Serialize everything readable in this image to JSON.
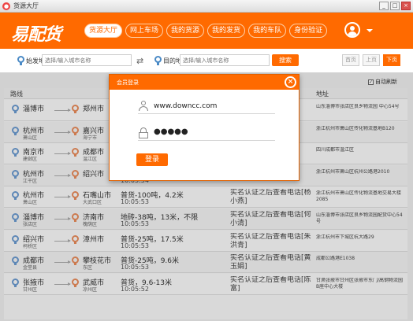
{
  "window": {
    "title": "货源大厅",
    "minimize": "_",
    "maximize": "□",
    "close": "×",
    "app_icon": "app-icon"
  },
  "brand": {
    "logo": "易配货"
  },
  "nav": [
    "货源大厅",
    "网上车场",
    "我的货源",
    "我的发货",
    "我的车队",
    "身份验证"
  ],
  "nav_active": 0,
  "search": {
    "from_label": "始发地",
    "from_placeholder": "选择/输入城市名称",
    "to_label": "目的地",
    "to_placeholder": "选择/输入城市名称",
    "swap": "⇄",
    "button": "搜索",
    "first": "首页",
    "prev": "上页",
    "next": "下页"
  },
  "auto_refresh": {
    "label": "自动刷新",
    "checked": true,
    "check": "✓"
  },
  "table": {
    "headers": {
      "route": "路线",
      "address": "地址"
    },
    "rows": [
      {
        "from": "淄博市",
        "from_sub": "",
        "to": "郑州市",
        "to_sub": "",
        "cargo": "",
        "time": "",
        "contact": "",
        "address": "山东淄博市张店区良乡物流园 中心54号"
      },
      {
        "from": "杭州市",
        "from_sub": "萧山区",
        "to": "嘉兴市",
        "to_sub": "海宁市",
        "cargo": "",
        "time": "",
        "contact": "",
        "address": "浙江杭州市萧山区传化物流基地B120"
      },
      {
        "from": "南京市",
        "from_sub": "建邺区",
        "to": "成都市",
        "to_sub": "温江区",
        "cargo": "",
        "time": "",
        "contact": "",
        "address": "四川成都市温江区"
      },
      {
        "from": "杭州市",
        "from_sub": "江干区",
        "to": "绍兴市",
        "to_sub": "",
        "cargo": "",
        "time": "10:05:54",
        "contact": "人]",
        "address": "浙江杭州市萧山区杭州公路港2010"
      },
      {
        "from": "杭州市",
        "from_sub": "萧山区",
        "to": "石嘴山市",
        "to_sub": "大武口区",
        "cargo": "普货-100吨，4.2米",
        "time": "10:05:53",
        "contact": "实名认证之后查看电话[杨小燕]",
        "address": "浙江杭州市萧山区传化物流基地交易大楼2085"
      },
      {
        "from": "淄博市",
        "from_sub": "张店区",
        "to": "济南市",
        "to_sub": "槐荫区",
        "cargo": "地砖-38吨，13米，不限",
        "time": "10:05:53",
        "contact": "实名认证之后查看电话[何小清]",
        "address": "山东淄博市张店区良乡物流园配货中心54号"
      },
      {
        "from": "绍兴市",
        "from_sub": "柯桥区",
        "to": "漳州市",
        "to_sub": "",
        "cargo": "普货-25吨，17.5米",
        "time": "10:05:53",
        "contact": "实名认证之后查看电话[朱洪青]",
        "address": "浙江杭州市下城区杭大路29"
      },
      {
        "from": "成都市",
        "from_sub": "金堂县",
        "to": "攀枝花市",
        "to_sub": "东区",
        "cargo": "普货-25吨，9.6米",
        "time": "10:05:53",
        "contact": "实名认证之后查看电话[黄玉娟]",
        "address": "成都公路港E1038"
      },
      {
        "from": "张掖市",
        "from_sub": "甘州区",
        "to": "武威市",
        "to_sub": "凉州区",
        "cargo": "普货，9.6-13米",
        "time": "10:05:52",
        "contact": "实名认证之后查看电话[陈富]",
        "address": "甘肃张掖市甘州区张掖市东门/高钢物流园B座中心大楼"
      }
    ]
  },
  "login": {
    "title": "会员登录",
    "close": "×",
    "username": "www.downcc.com",
    "password": "●●●●●",
    "button": "登录"
  }
}
